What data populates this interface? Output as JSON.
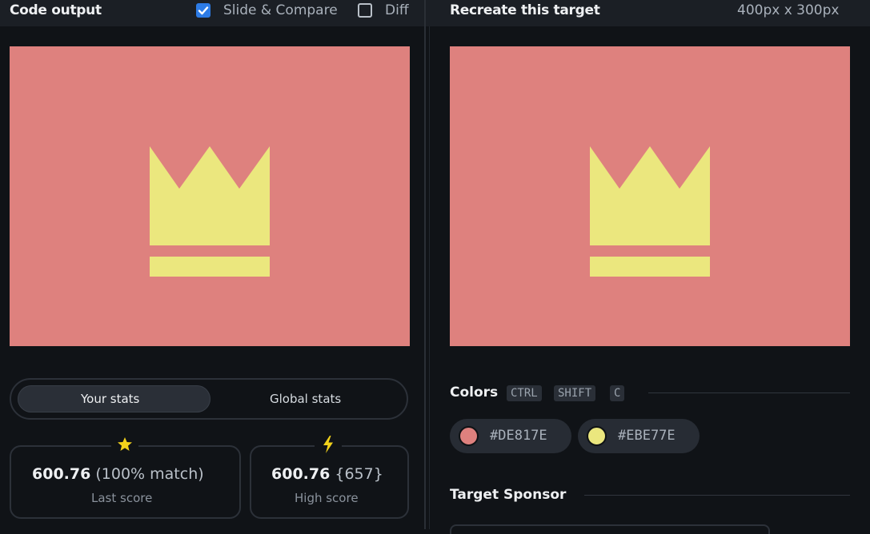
{
  "header": {
    "left_title": "Code output",
    "slide_compare_label": "Slide & Compare",
    "diff_label": "Diff",
    "right_title": "Recreate this target",
    "dimensions": "400px x 300px"
  },
  "checkboxes": {
    "slide_compare_checked": true,
    "diff_checked": false
  },
  "canvas": {
    "background": "#DE817E",
    "crown_color": "#EBE77E"
  },
  "stats_toggle": {
    "your_stats": "Your stats",
    "global_stats": "Global stats",
    "selected": "Your stats"
  },
  "stats": {
    "last_score_value": "600.76",
    "last_score_match": "(100% match)",
    "last_score_label": "Last score",
    "high_score_value": "600.76",
    "high_score_extra": "{657}",
    "high_score_label": "High score",
    "last_icon": "star-icon",
    "high_icon": "lightning-icon"
  },
  "colors_section": {
    "label": "Colors",
    "shortcut_keys": [
      "CTRL",
      "SHIFT",
      "C"
    ],
    "swatches": [
      {
        "hex": "#DE817E",
        "color": "#DE817E"
      },
      {
        "hex": "#EBE77E",
        "color": "#EBE77E"
      }
    ]
  },
  "sponsor_section": {
    "label": "Target Sponsor"
  }
}
